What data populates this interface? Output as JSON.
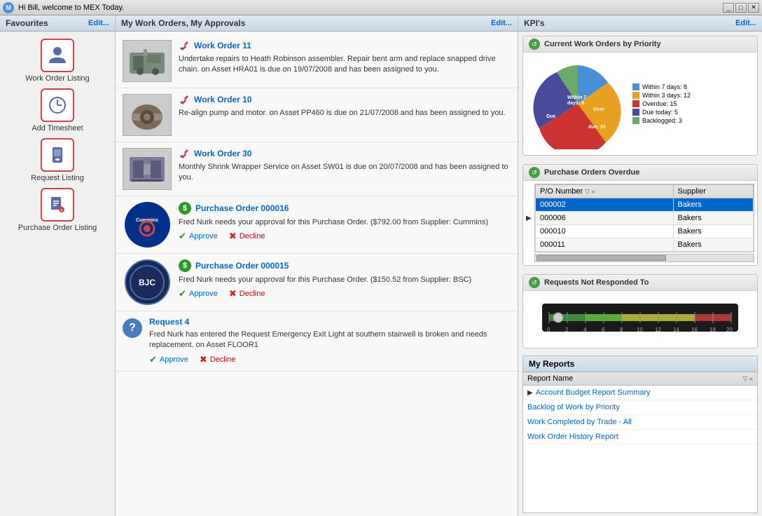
{
  "titleBar": {
    "greeting": "Hi Bill, welcome to MEX Today."
  },
  "favourites": {
    "title": "Favourites",
    "editLabel": "Edit...",
    "items": [
      {
        "id": "work-order-listing",
        "label": "Work Order Listing",
        "icon": "person"
      },
      {
        "id": "add-timesheet",
        "label": "Add Timesheet",
        "icon": "clock"
      },
      {
        "id": "request-listing",
        "label": "Request Listing",
        "icon": "phone"
      },
      {
        "id": "purchase-order-listing",
        "label": "Purchase Order Listing",
        "icon": "document"
      }
    ]
  },
  "workOrders": {
    "title": "My Work Orders, My Approvals",
    "editLabel": "Edit...",
    "items": [
      {
        "id": "wo11",
        "type": "workorder",
        "title": "Work Order 11",
        "description": "Undertake repairs to Heath Robinson assembler.  Repair bent arm and replace snapped drive chain. on Asset HRA01 is due on 19/07/2008 and has been assigned to you.",
        "hasImage": true,
        "imageType": "assembler"
      },
      {
        "id": "wo10",
        "type": "workorder",
        "title": "Work Order 10",
        "description": "Re-align pump and motor. on Asset PP460 is due on 21/07/2008 and has been assigned to you.",
        "hasImage": true,
        "imageType": "pump"
      },
      {
        "id": "wo30",
        "type": "workorder",
        "title": "Work Order 30",
        "description": "Monthly Shrink Wrapper Service on Asset SW01 is due on 20/07/2008 and has been assigned to you.",
        "hasImage": true,
        "imageType": "shrink"
      },
      {
        "id": "po16",
        "type": "purchaseorder",
        "title": "Purchase Order 000016",
        "description": "Fred Nurk needs your approval for this Purchase Order. ($792.00 from Supplier: Cummins)",
        "imageType": "cummins",
        "approveLabel": "Approve",
        "declineLabel": "Decline"
      },
      {
        "id": "po15",
        "type": "purchaseorder",
        "title": "Purchase Order 000015",
        "description": "Fred Nurk needs your approval for this Purchase Order. ($150.52 from Supplier: BSC)",
        "imageType": "bjc",
        "approveLabel": "Approve",
        "declineLabel": "Decline"
      },
      {
        "id": "req4",
        "type": "request",
        "title": "Request 4",
        "description": "Fred Nurk has entered the Request Emergency Exit Light at southern stairwell is broken and needs replacement. on Asset FLOOR1",
        "approveLabel": "Approve",
        "declineLabel": "Decline"
      }
    ]
  },
  "kpis": {
    "title": "KPI's",
    "editLabel": "Edit...",
    "pieChart": {
      "title": "Current Work Orders by Priority",
      "segments": [
        {
          "label": "Within 7 days: 8",
          "color": "#4a90d9",
          "percent": 20
        },
        {
          "label": "Within 3 days: 12",
          "color": "#e8a020",
          "percent": 28
        },
        {
          "label": "Overdue: 15",
          "color": "#cc3333",
          "percent": 35
        },
        {
          "label": "Due today: 5",
          "color": "#4a4a9a",
          "percent": 12
        },
        {
          "label": "Backlogged: 3",
          "color": "#6aaa6a",
          "percent": 5
        }
      ]
    },
    "purchaseOrders": {
      "title": "Purchase Orders Overdue",
      "columns": [
        "P/O Number",
        "Supplier"
      ],
      "rows": [
        {
          "po": "000002",
          "supplier": "Bakers",
          "selected": true
        },
        {
          "po": "000006",
          "supplier": "Bakers",
          "selected": false
        },
        {
          "po": "000010",
          "supplier": "Bakers",
          "selected": false
        },
        {
          "po": "000011",
          "supplier": "Bakers",
          "selected": false
        }
      ]
    },
    "requests": {
      "title": "Requests Not Responded To"
    }
  },
  "myReports": {
    "title": "My Reports",
    "columnHeader": "Report Name",
    "reports": [
      {
        "id": "account-budget",
        "name": "Account Budget Report Summary"
      },
      {
        "id": "backlog",
        "name": "Backlog of Work by Priority"
      },
      {
        "id": "work-completed",
        "name": "Work Completed by Trade - All"
      },
      {
        "id": "wo-history",
        "name": "Work Order History Report"
      }
    ]
  }
}
